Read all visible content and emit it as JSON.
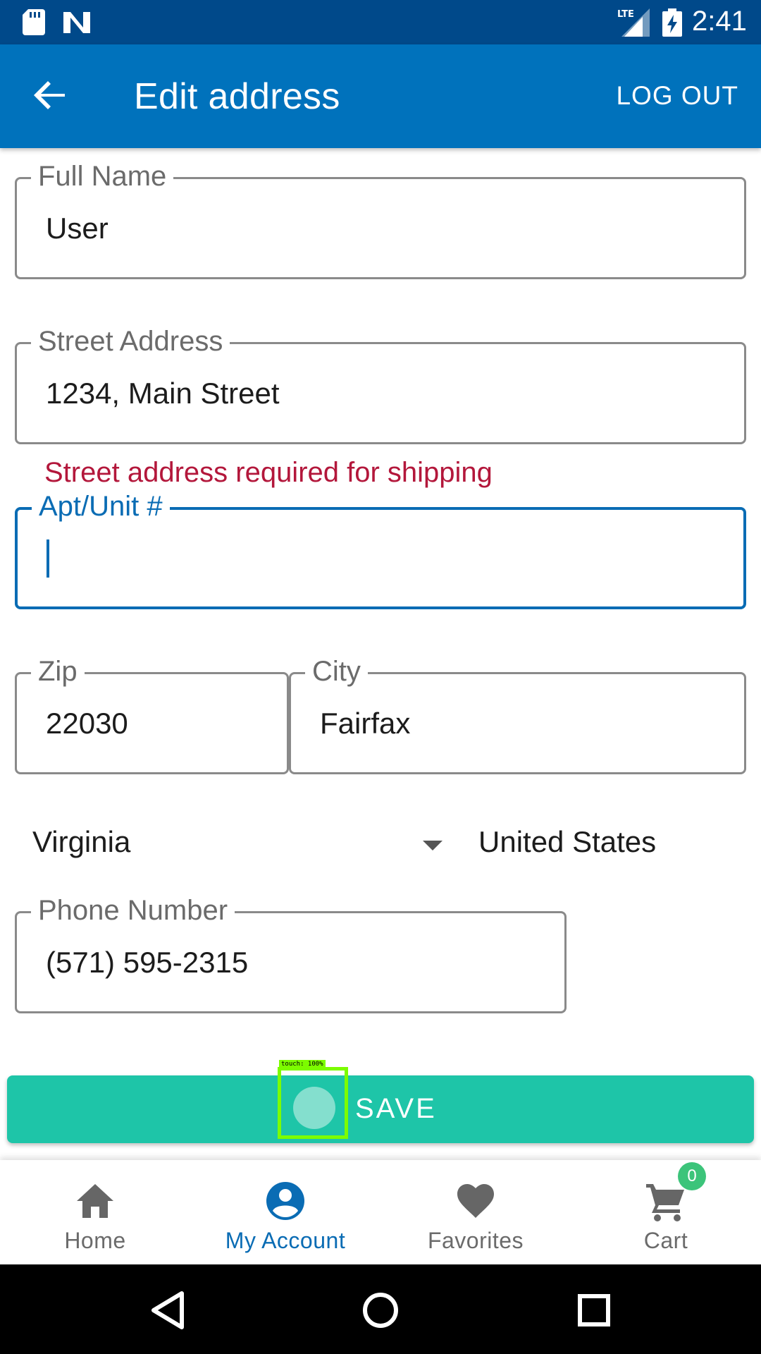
{
  "status_bar": {
    "time": "2:41",
    "icons": [
      "sd-card-icon",
      "n-logo-icon",
      "lte-signal-icon",
      "battery-charging-icon"
    ]
  },
  "app_bar": {
    "title": "Edit address",
    "logout_label": "LOG OUT",
    "back_icon": "arrow-left-icon"
  },
  "form": {
    "full_name": {
      "label": "Full Name",
      "value": "User"
    },
    "street_address": {
      "label": "Street Address",
      "value": "1234, Main Street",
      "error": "Street address required for shipping"
    },
    "apt_unit": {
      "label": "Apt/Unit #",
      "value": "",
      "focused": true
    },
    "zip": {
      "label": "Zip",
      "value": "22030"
    },
    "city": {
      "label": "City",
      "value": "Fairfax"
    },
    "state": {
      "value": "Virginia"
    },
    "country": {
      "value": "United States"
    },
    "phone": {
      "label": "Phone Number",
      "value": "(571) 595-2315"
    }
  },
  "save_button": {
    "label": "SAVE"
  },
  "touch_indicator": {
    "label": "touch: 100%"
  },
  "bottom_nav": {
    "items": [
      {
        "label": "Home",
        "icon": "home-icon",
        "active": false
      },
      {
        "label": "My Account",
        "icon": "account-circle-icon",
        "active": true
      },
      {
        "label": "Favorites",
        "icon": "heart-icon",
        "active": false
      },
      {
        "label": "Cart",
        "icon": "cart-icon",
        "active": false
      }
    ],
    "cart_badge": "0"
  },
  "colors": {
    "status_bar": "#00498a",
    "app_bar": "#0072bc",
    "accent": "#0a6cb4",
    "error": "#b3173b",
    "save": "#1ec5a8",
    "badge": "#3cc47a"
  }
}
